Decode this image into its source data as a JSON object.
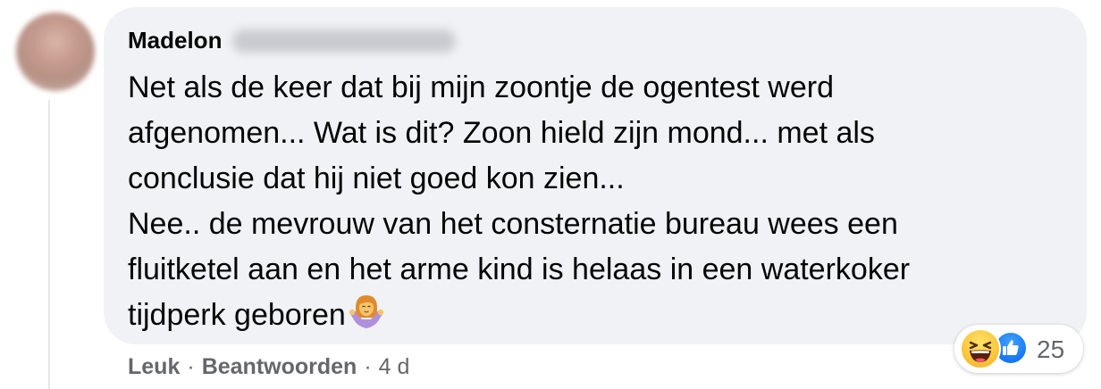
{
  "comment": {
    "author_first_name": "Madelon",
    "text_lines": [
      "Net als de keer dat bij mijn zoontje de ogentest werd",
      "afgenomen... Wat is dit? Zoon hield zijn mond... met als",
      "conclusie dat hij niet goed kon zien...",
      "Nee.. de mevrouw van het consternatie bureau wees een",
      "fluitketel aan en het arme kind is helaas in een waterkoker",
      "tijdperk geboren"
    ],
    "trailing_emoji": "woman-shrugging-emoji"
  },
  "reactions": {
    "icons": [
      "haha-reaction-icon",
      "like-reaction-icon"
    ],
    "count": "25"
  },
  "actions": {
    "like_label": "Leuk",
    "separator": "·",
    "reply_label": "Beantwoorden",
    "timestamp": "4 d"
  },
  "colors": {
    "bubble_bg": "#f0f2f5",
    "text": "#050505",
    "secondary_text": "#65676b",
    "like_blue": "#1877f2",
    "haha_yellow": "#fbc93f"
  }
}
